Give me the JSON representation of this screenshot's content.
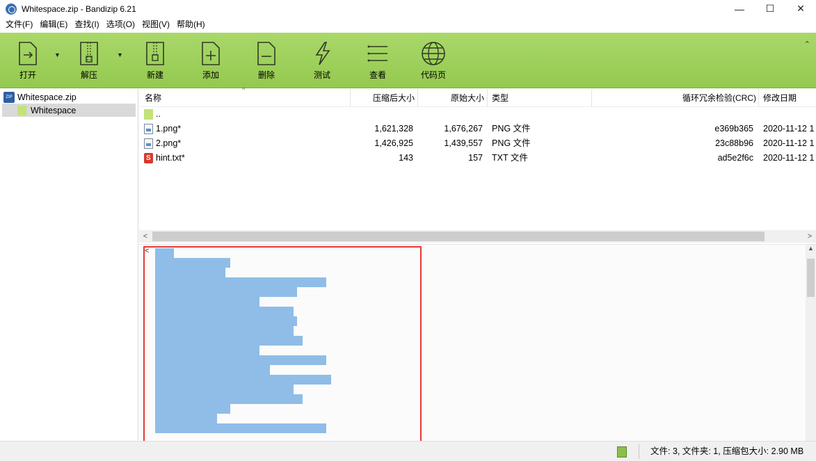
{
  "window": {
    "title": "Whitespace.zip - Bandizip 6.21",
    "controls": {
      "minimize": "—",
      "maximize": "☐",
      "close": "✕"
    }
  },
  "menu": [
    "文件(F)",
    "编辑(E)",
    "查找(I)",
    "选项(O)",
    "视图(V)",
    "帮助(H)"
  ],
  "toolbar": {
    "open": "打开",
    "extract": "解压",
    "new": "新建",
    "add": "添加",
    "delete": "删除",
    "test": "测试",
    "view": "查看",
    "codepage": "代码页",
    "collapse": "⌃"
  },
  "tree": {
    "root": "Whitespace.zip",
    "child": "Whitespace"
  },
  "list": {
    "columns": {
      "name": "名称",
      "compressed": "压缩后大小",
      "original": "原始大小",
      "type": "类型",
      "crc": "循环冗余检验(CRC)",
      "modified": "修改日期"
    },
    "rows": [
      {
        "icon": "folder-icon",
        "name": "..",
        "compressed": "",
        "original": "",
        "type": "",
        "crc": "",
        "modified": ""
      },
      {
        "icon": "png-file-icon",
        "name": "1.png*",
        "compressed": "1,621,328",
        "original": "1,676,267",
        "type": "PNG 文件",
        "crc": "e369b365",
        "modified": "2020-11-12 1"
      },
      {
        "icon": "png-file-icon",
        "name": "2.png*",
        "compressed": "1,426,925",
        "original": "1,439,557",
        "type": "PNG 文件",
        "crc": "23c88b96",
        "modified": "2020-11-12 1"
      },
      {
        "icon": "txt-file-icon",
        "name": "hint.txt*",
        "compressed": "143",
        "original": "157",
        "type": "TXT 文件",
        "crc": "ad5e2f6c",
        "modified": "2020-11-12 1"
      }
    ]
  },
  "preview": {
    "selection_color": "#8fbde8",
    "highlight_color": "#e53935",
    "line_fractions": [
      0.11,
      0.44,
      0.41,
      1.0,
      0.83,
      0.61,
      0.81,
      0.83,
      0.81,
      0.86,
      0.61,
      1.0,
      0.67,
      1.03,
      0.81,
      0.86,
      0.44,
      0.36,
      1.0
    ]
  },
  "status": {
    "text": "文件: 3, 文件夹: 1, 压缩包大小: 2.90 MB"
  },
  "colors": {
    "toolbar_green": "#a9d86a",
    "tree_selection": "#d9d9d9"
  }
}
